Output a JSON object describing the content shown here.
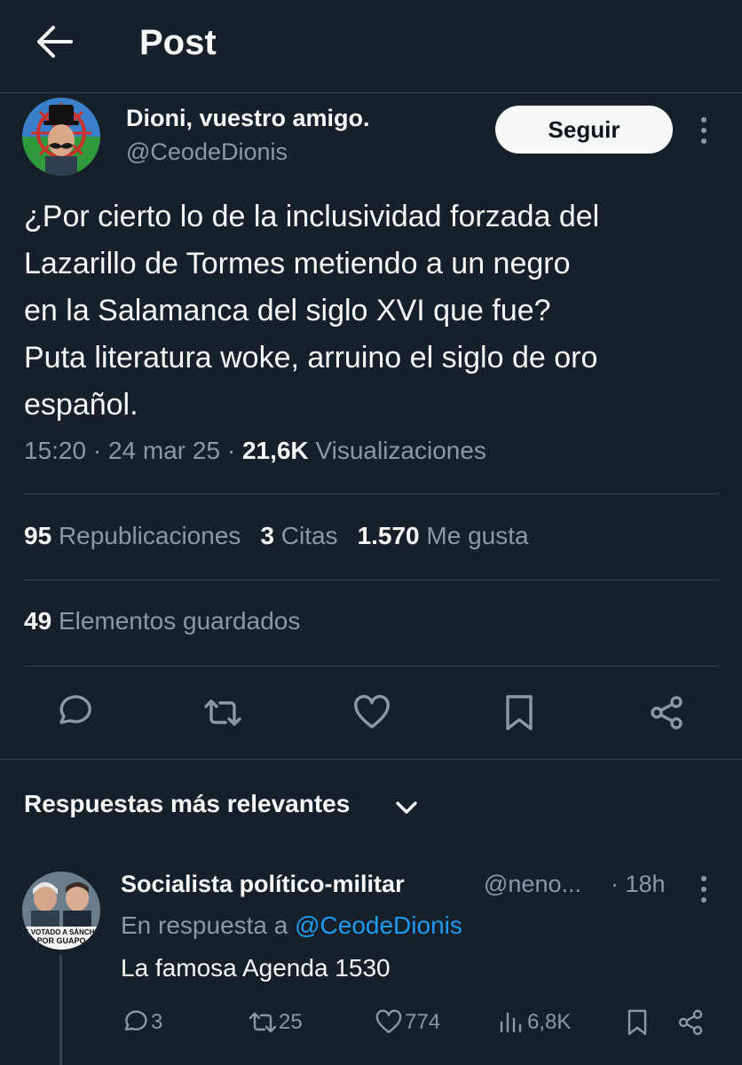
{
  "header": {
    "title": "Post"
  },
  "tweet": {
    "author_name": "Dioni, vuestro amigo.",
    "author_handle": "@CeodeDionis",
    "follow_label": "Seguir",
    "text": "¿Por cierto lo de la inclusividad forzada del\nLazarillo de Tormes metiendo a un negro\nen la Salamanca del siglo XVI que fue?\nPuta literatura woke, arruino el siglo de oro\nespañol.",
    "time": "15:20",
    "date": "24 mar 25",
    "views_count": "21,6K",
    "views_label": "Visualizaciones"
  },
  "stats": {
    "reposts_count": "95",
    "reposts_label": "Republicaciones",
    "quotes_count": "3",
    "quotes_label": "Citas",
    "likes_count": "1.570",
    "likes_label": "Me gusta",
    "bookmarks_count": "49",
    "bookmarks_label": "Elementos guardados"
  },
  "replies_section": {
    "sort_label": "Respuestas más relevantes"
  },
  "reply": {
    "author_name": "Socialista político-militar",
    "author_handle": "@neno...",
    "separator": "·",
    "time": "18h",
    "reply_to_prefix": "En respuesta a",
    "reply_to_handle": "@CeodeDionis",
    "text": "La famosa Agenda 1530",
    "avatar_caption_1": "HE VOTADO A SÁNCHEZ",
    "avatar_caption_2": "POR GUAPO",
    "replies": "3",
    "reposts": "25",
    "likes": "774",
    "views": "6,8K"
  },
  "colors": {
    "background": "#15202b",
    "divider": "#38444d",
    "text": "#f7f9f9",
    "secondary": "#8b98a5",
    "link": "#1d9bf0"
  }
}
